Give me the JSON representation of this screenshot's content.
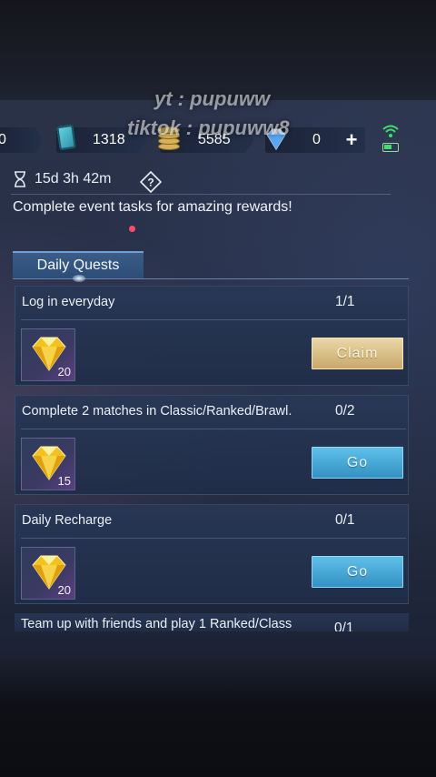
{
  "watermark": {
    "line1": "yt : pupuww",
    "line2": "tiktok : pupuww8"
  },
  "currency": {
    "left_value": "0",
    "tickets": "1318",
    "gold": "5585",
    "gems": "0"
  },
  "event": {
    "timer": "15d 3h 42m",
    "description": "Complete event tasks for amazing rewards!"
  },
  "tabs": [
    {
      "label": "Daily Quests",
      "has_notification": true
    }
  ],
  "quests": [
    {
      "title": "Log in everyday",
      "progress": "1/1",
      "reward_qty": "20",
      "button": "Claim",
      "button_style": "claim"
    },
    {
      "title": "Complete 2 matches in Classic/Ranked/Brawl.",
      "progress": "0/2",
      "reward_qty": "15",
      "button": "Go",
      "button_style": "go"
    },
    {
      "title": "Daily Recharge",
      "progress": "0/1",
      "reward_qty": "20",
      "button": "Go",
      "button_style": "go"
    },
    {
      "title": "Team up with friends and play 1 Ranked/Class",
      "progress": "0/1"
    }
  ],
  "colors": {
    "claim": "#d9bf86",
    "go": "#49a8d6",
    "notification": "#ff4d6a"
  }
}
